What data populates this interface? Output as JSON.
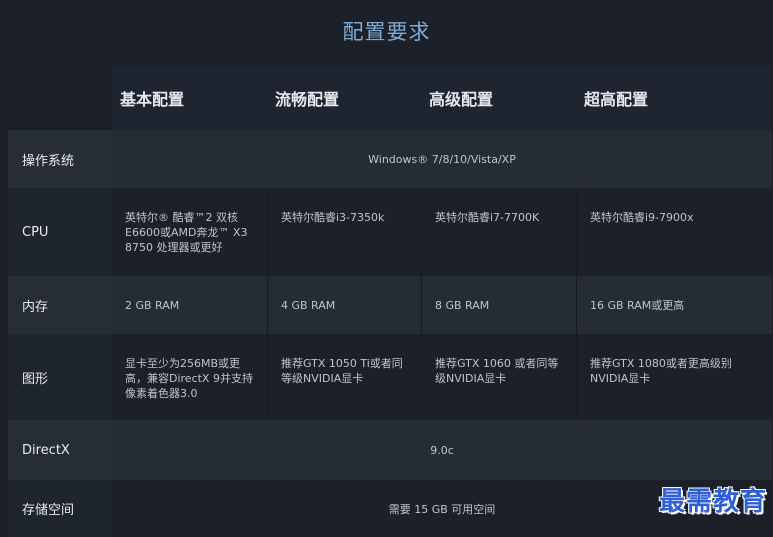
{
  "title": "配置要求",
  "headers": [
    "基本配置",
    "流畅配置",
    "高级配置",
    "超高配置"
  ],
  "rows": {
    "os": {
      "label": "操作系统",
      "value": "Windows® 7/8/10/Vista/XP"
    },
    "cpu": {
      "label": "CPU",
      "values": [
        "英特尔® 酷睿™2 双核 E6600或AMD奔龙™ X3 8750 处理器或更好",
        "英特尔酷睿i3-7350k",
        "英特尔酷睿i7-7700K",
        "英特尔酷睿i9-7900x"
      ]
    },
    "ram": {
      "label": "内存",
      "values": [
        "2 GB RAM",
        "4 GB RAM",
        "8 GB RAM",
        "16 GB RAM或更高"
      ]
    },
    "gpu": {
      "label": "图形",
      "values": [
        "显卡至少为256MB或更高，兼容DirectX 9并支持像素着色器3.0",
        "推荐GTX 1050 Ti或者同等级NVIDIA显卡",
        "推荐GTX 1060 或者同等级NVIDIA显卡",
        "推荐GTX 1080或者更高级别NVIDIA显卡"
      ]
    },
    "directx": {
      "label": "DirectX",
      "value": "9.0c"
    },
    "storage": {
      "label": "存储空间",
      "value": "需要 15 GB 可用空间"
    }
  },
  "watermark": "最需教育"
}
